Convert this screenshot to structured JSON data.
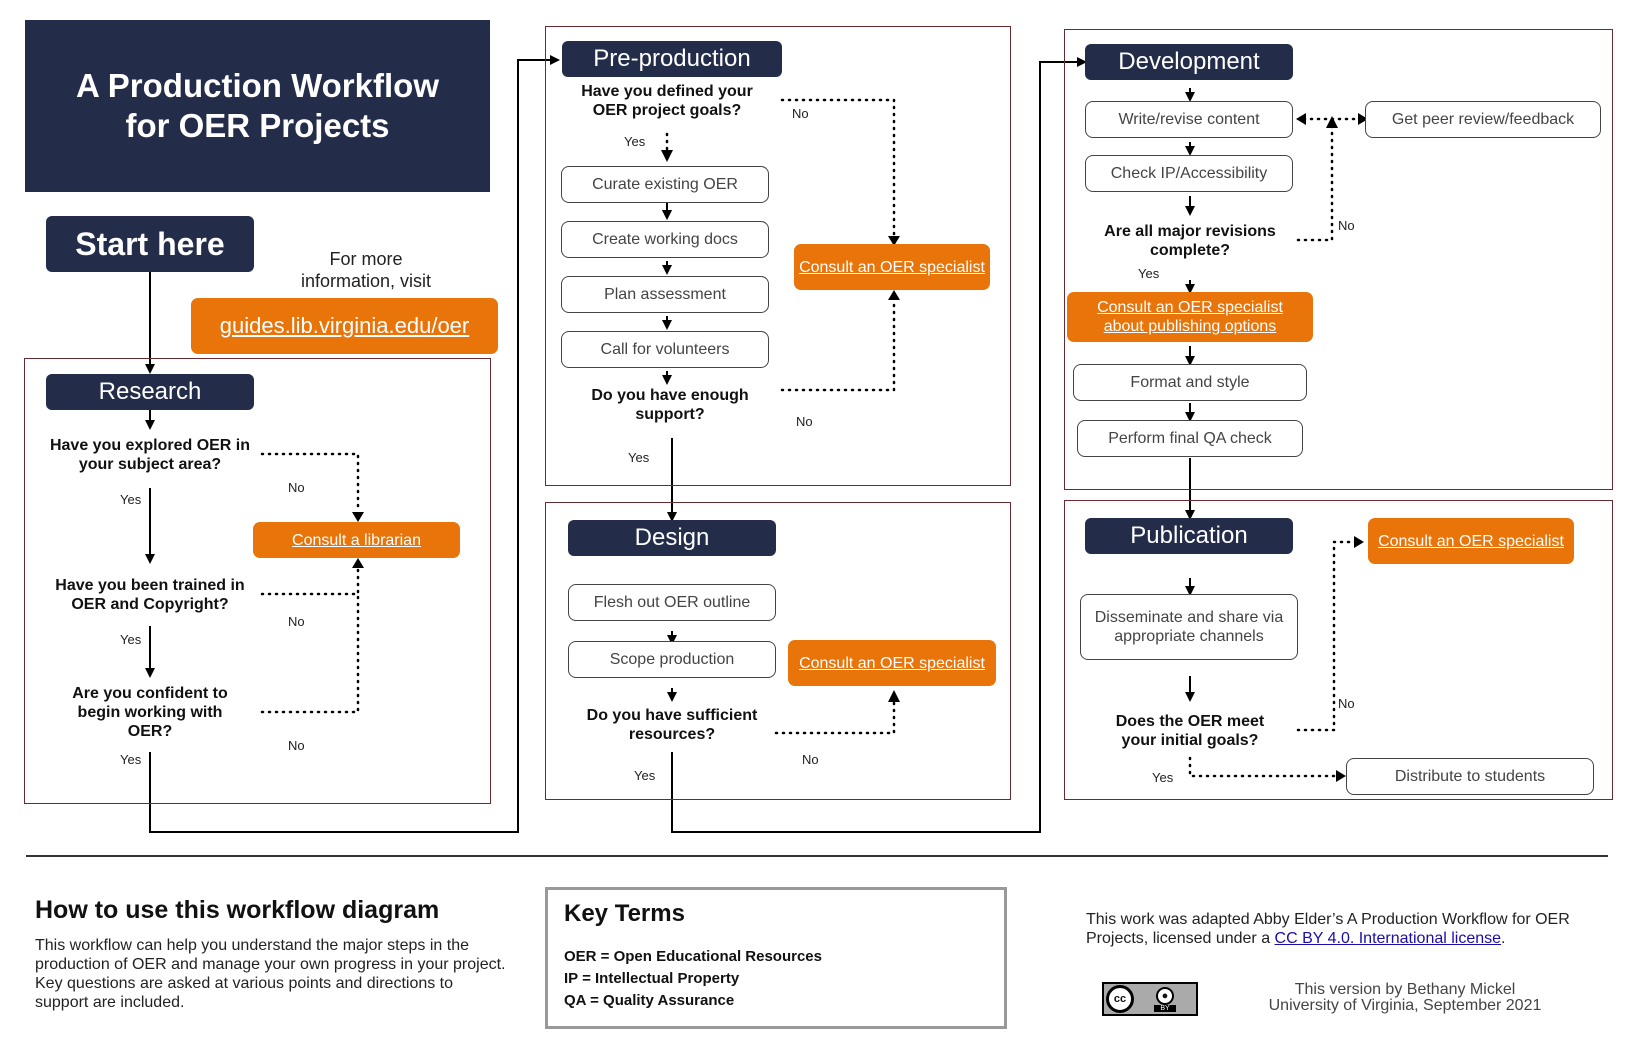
{
  "title": {
    "line1": "A Production Workflow",
    "line2": "for OER Projects"
  },
  "start": "Start here",
  "more_info": {
    "line1": "For more",
    "line2": "information, visit",
    "link": "guides.lib.virginia.edu/oer"
  },
  "colors": {
    "navy": "#232c49",
    "orange": "#e8740a",
    "panel_border": "#6b2a30",
    "link_blue": "#1a0dab"
  },
  "research": {
    "stage": "Research",
    "q1": "Have you explored OER in your subject area?",
    "q2": "Have you been trained in OER and Copyright?",
    "q3": "Are you confident to begin working with OER?",
    "consult": "Consult a librarian"
  },
  "preproduction": {
    "stage": "Pre-production",
    "q1": "Have you defined your OER project goals?",
    "steps": [
      "Curate existing OER",
      "Create working docs",
      "Plan assessment",
      "Call for volunteers"
    ],
    "q2": "Do you have enough support?",
    "consult": "Consult an OER specialist"
  },
  "design": {
    "stage": "Design",
    "steps": [
      "Flesh out OER outline",
      "Scope production"
    ],
    "q1": "Do you have sufficient resources?",
    "consult": "Consult an OER specialist"
  },
  "development": {
    "stage": "Development",
    "steps": [
      "Write/revise content",
      "Check IP/Accessibility"
    ],
    "peer": "Get peer review/feedback",
    "q1": "Are all major revisions complete?",
    "consult": "Consult an OER specialist about publishing options",
    "steps2": [
      "Format and style",
      "Perform final QA check"
    ]
  },
  "publication": {
    "stage": "Publication",
    "step": "Disseminate and share via appropriate channels",
    "q1": "Does the OER meet your initial goals?",
    "consult": "Consult an OER specialist",
    "distribute": "Distribute to students"
  },
  "labels": {
    "yes": "Yes",
    "no": "No"
  },
  "how_to": {
    "heading": "How to use this workflow diagram",
    "body": "This workflow can help you understand the major steps in the production of OER and manage your own progress in your project. Key questions are asked at various points and directions to support are included."
  },
  "key_terms": {
    "heading": "Key Terms",
    "items": [
      "OER = Open Educational Resources",
      "IP = Intellectual Property",
      "QA = Quality Assurance"
    ]
  },
  "attribution": {
    "text_before": "This work was adapted Abby Elder’s A Production Workflow for OER Projects, licensed under a ",
    "link": "CC BY 4.0. International license",
    "text_after": ".",
    "version_line1": "This version by Bethany Mickel",
    "version_line2": "University of Virginia, September 2021",
    "badge": {
      "cc": "cc",
      "by": "BY"
    }
  }
}
